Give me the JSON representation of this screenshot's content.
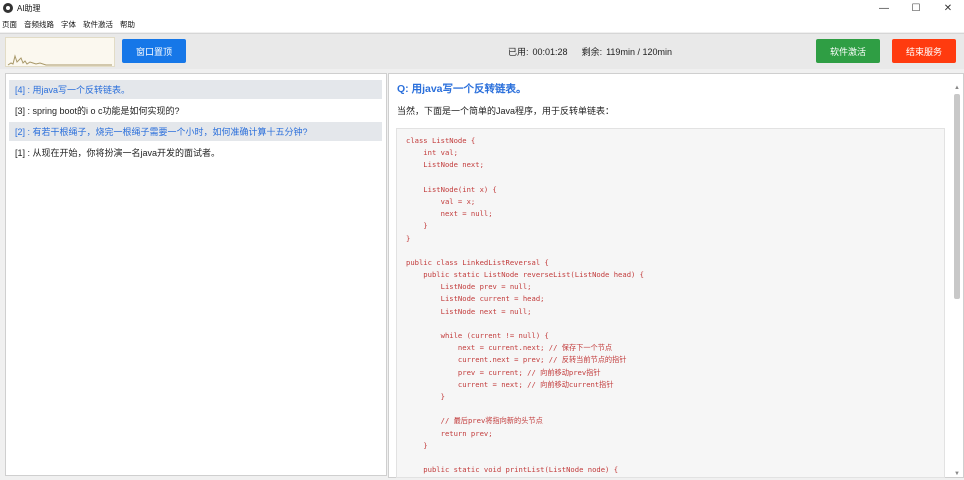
{
  "window": {
    "title": "AI助理",
    "controls": {
      "minimize": "—",
      "maximize": "☐",
      "close": "✕"
    }
  },
  "menu": [
    "页面",
    "音频线路",
    "字体",
    "软件激活",
    "帮助"
  ],
  "toolbar": {
    "pin_button": "窗口置顶",
    "used_label": "已用:",
    "used_value": "00:01:28",
    "remaining_label": "剩余:",
    "remaining_value": "119min / 120min",
    "activate_button": "软件激活",
    "end_button": "结束服务"
  },
  "history": [
    {
      "text": "[4] : 用java写一个反转链表。",
      "highlighted": true
    },
    {
      "text": "[3] : spring boot的i o c功能是如何实现的?",
      "highlighted": false
    },
    {
      "text": "[2] : 有若干根绳子，烧完一根绳子需要一个小时，如何准确计算十五分钟?",
      "highlighted": true
    },
    {
      "text": "[1] : 从现在开始，你将扮演一名java开发的面试者。",
      "highlighted": false
    }
  ],
  "answer": {
    "question": "Q: 用java写一个反转链表。",
    "intro": "当然，下面是一个简单的Java程序，用于反转单链表：",
    "code": [
      "class ListNode {",
      "    int val;",
      "    ListNode next;",
      "",
      "    ListNode(int x) {",
      "        val = x;",
      "        next = null;",
      "    }",
      "}",
      "",
      "public class LinkedListReversal {",
      "    public static ListNode reverseList(ListNode head) {",
      "        ListNode prev = null;",
      "        ListNode current = head;",
      "        ListNode next = null;",
      "",
      "        while (current != null) {",
      "            next = current.next; // 保存下一个节点",
      "            current.next = prev; // 反转当前节点的指针",
      "            prev = current; // 向前移动prev指针",
      "            current = next; // 向前移动current指针",
      "        }",
      "",
      "        // 最后prev将指向新的头节点",
      "        return prev;",
      "    }",
      "",
      "    public static void printList(ListNode node) {"
    ]
  },
  "colors": {
    "accent_blue": "#1677e8",
    "activate_green": "#2f9e44",
    "end_red": "#ff3b0f",
    "question_blue": "#2a6fdb",
    "code_red": "#c23b3b"
  }
}
